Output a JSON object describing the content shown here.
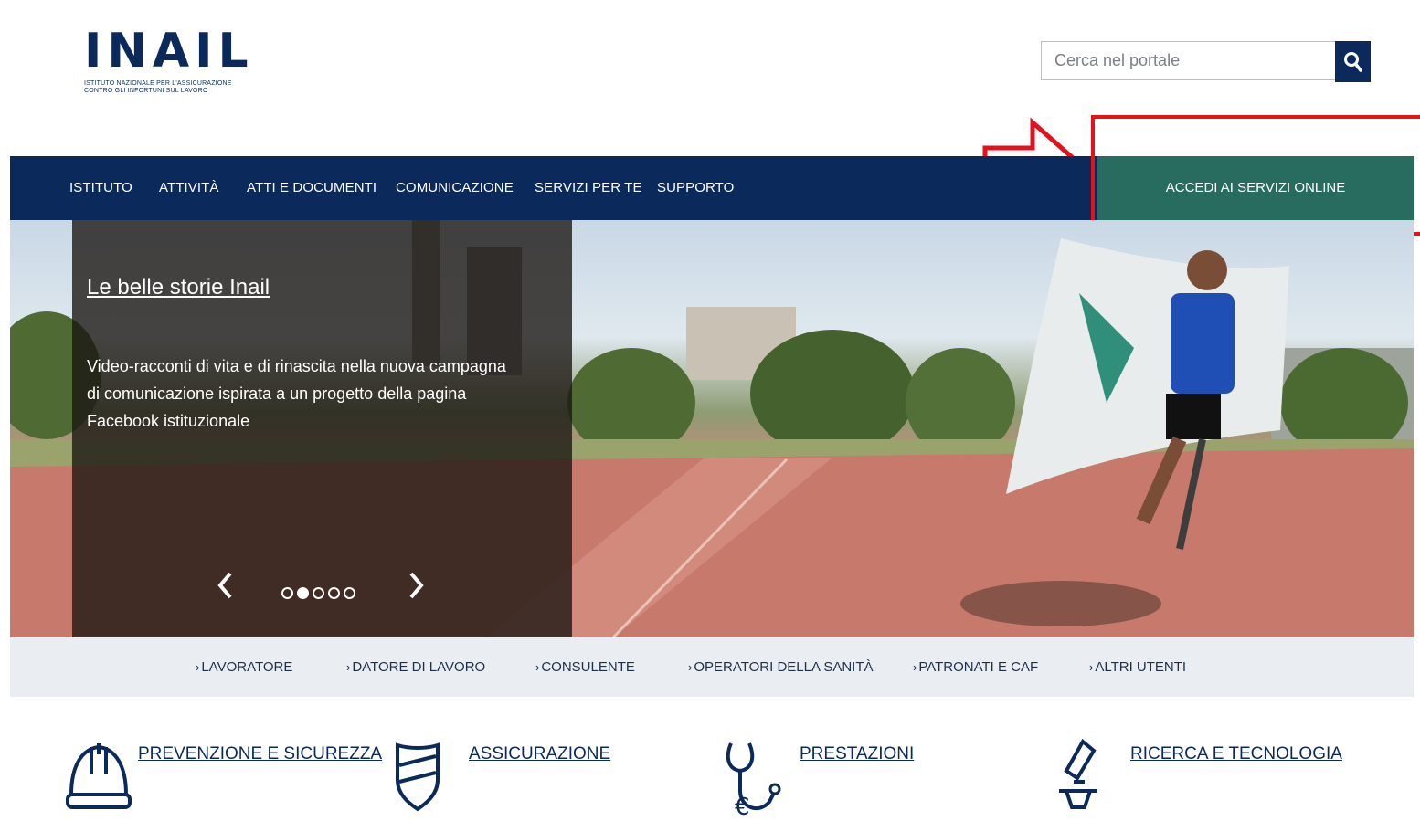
{
  "header": {
    "logo_text": "INAIL",
    "logo_subtitle": "Istituto nazionale per l'assicurazione contro gli infortuni sul lavoro",
    "search_placeholder": "Cerca nel portale"
  },
  "nav": {
    "items": [
      "ISTITUTO",
      "ATTIVITÀ",
      "ATTI E DOCUMENTI",
      "COMUNICAZIONE",
      "SERVIZI PER TE",
      "SUPPORTO"
    ],
    "cta_label": "ACCEDI AI SERVIZI ONLINE"
  },
  "hero": {
    "title": "Le belle storie Inail",
    "description": "Video-racconti di vita e di rinascita nella nuova campagna di comunicazione ispirata a un progetto della pagina Facebook istituzionale",
    "active_slide": 2,
    "slide_count": 5
  },
  "audience": {
    "items": [
      "LAVORATORE",
      "DATORE DI LAVORO",
      "CONSULENTE",
      "OPERATORI DELLA SANITÀ",
      "PATRONATI E CAF",
      "ALTRI UTENTI"
    ]
  },
  "sections": {
    "items": [
      "PREVENZIONE E SICUREZZA",
      "ASSICURAZIONE",
      "PRESTAZIONI",
      "RICERCA E TECNOLOGIA"
    ],
    "icons": [
      "helmet-icon",
      "shield-icon",
      "stethoscope-euro-icon",
      "microscope-icon"
    ]
  },
  "colors": {
    "primary": "#0b2a5b",
    "cta": "#276c5f",
    "highlight": "#e3121b",
    "audience_bg": "#eaeef3"
  }
}
